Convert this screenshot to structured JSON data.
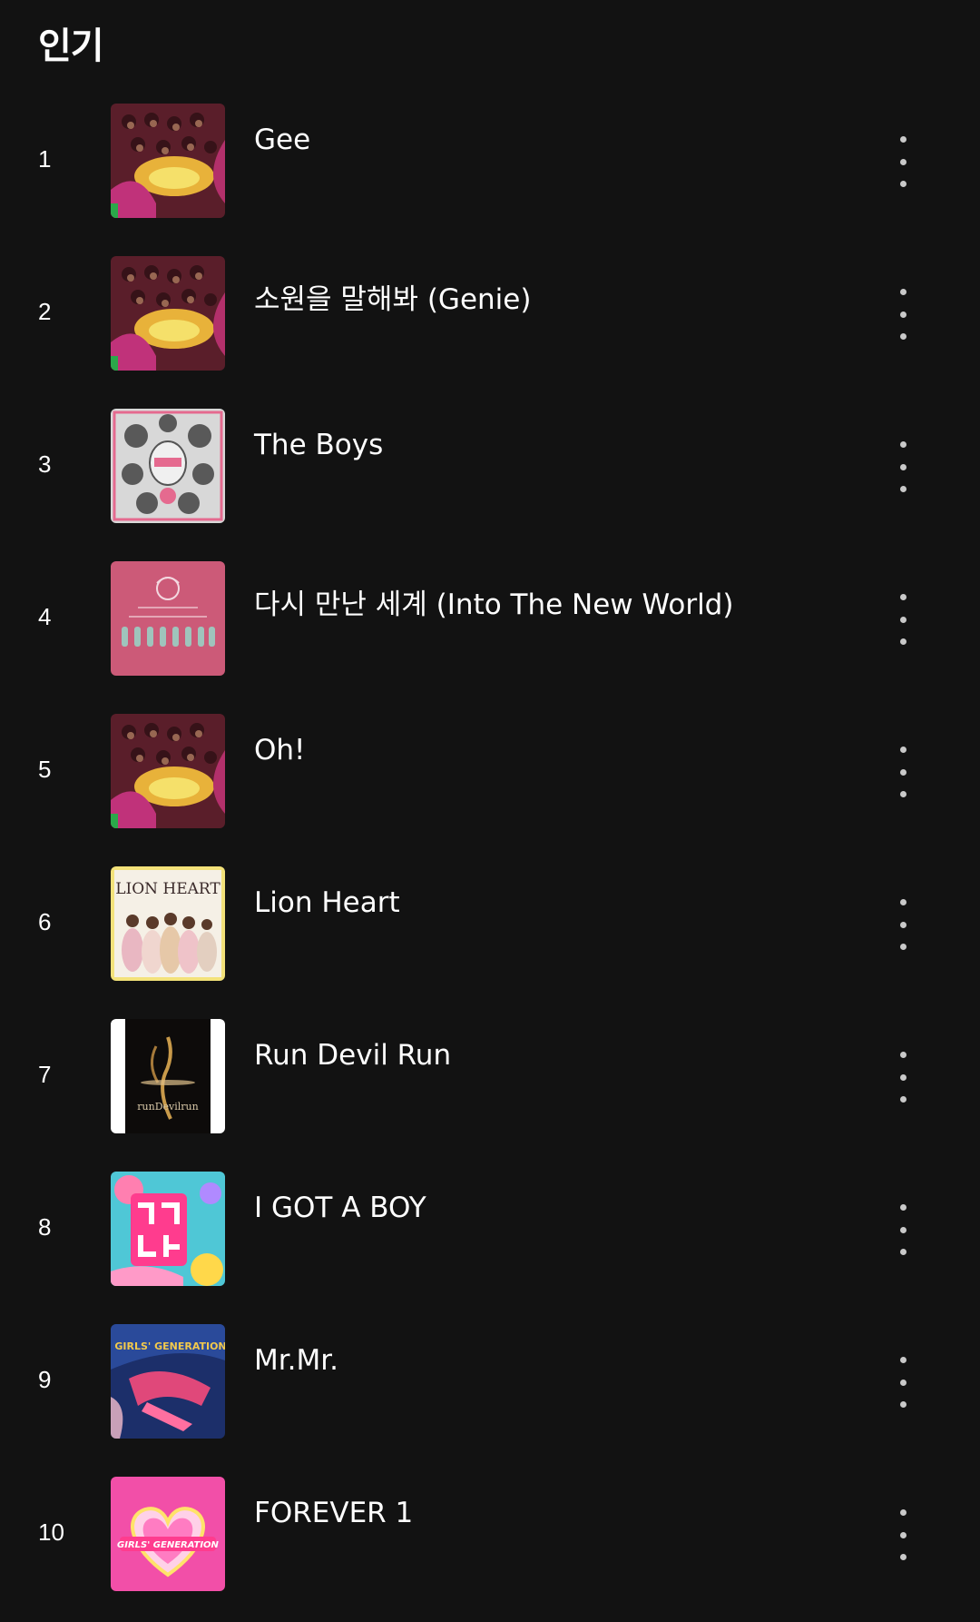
{
  "section": {
    "title": "인기"
  },
  "tracks": [
    {
      "rank": "1",
      "title": "Gee",
      "cover_icon": "album-cover-gee"
    },
    {
      "rank": "2",
      "title": "소원을 말해봐 (Genie)",
      "cover_icon": "album-cover-genie"
    },
    {
      "rank": "3",
      "title": "The Boys",
      "cover_icon": "album-cover-the-boys"
    },
    {
      "rank": "4",
      "title": "다시 만난 세계 (Into The New World)",
      "cover_icon": "album-cover-girls-generation"
    },
    {
      "rank": "5",
      "title": "Oh!",
      "cover_icon": "album-cover-oh"
    },
    {
      "rank": "6",
      "title": "Lion Heart",
      "cover_icon": "album-cover-lion-heart"
    },
    {
      "rank": "7",
      "title": "Run Devil Run",
      "cover_icon": "album-cover-run-devil-run"
    },
    {
      "rank": "8",
      "title": "I GOT A BOY",
      "cover_icon": "album-cover-i-got-a-boy"
    },
    {
      "rank": "9",
      "title": "Mr.Mr.",
      "cover_icon": "album-cover-mr-mr"
    },
    {
      "rank": "10",
      "title": "FOREVER 1",
      "cover_icon": "album-cover-forever-1"
    }
  ],
  "cover_text": {
    "lion_heart": "LION HEART",
    "run_devil_run": "runDevilrun",
    "mr_mr": "GIRLS' GENERATION",
    "forever_1": "GIRLS' GENERATION"
  },
  "colors": {
    "background": "#121212",
    "text": "#ffffff",
    "menu_dots": "#c9c9c9"
  }
}
